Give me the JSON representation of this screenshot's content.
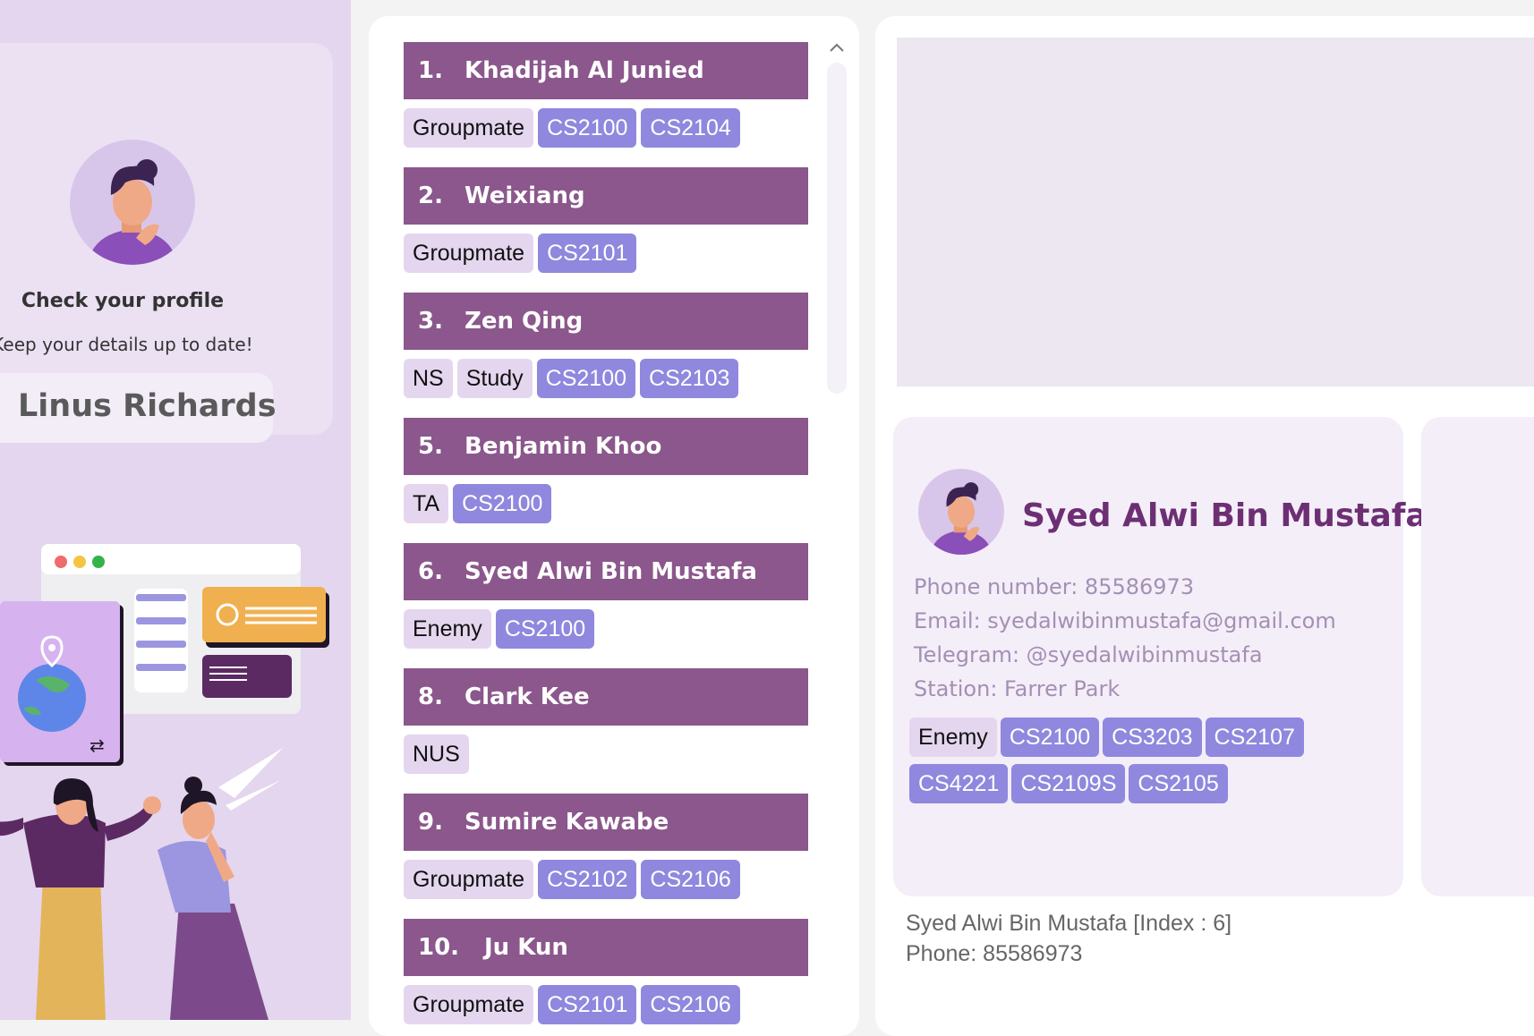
{
  "sidebar": {
    "profile_heading": "Check your profile",
    "profile_subtitle": "Keep your details up to date!",
    "user_name": "Linus Richards"
  },
  "contacts": [
    {
      "index": "1.",
      "name": "Khadijah Al Junied",
      "tags": [
        "Groupmate"
      ],
      "modules": [
        "CS2100",
        "CS2104"
      ]
    },
    {
      "index": "2.",
      "name": "Weixiang",
      "tags": [
        "Groupmate"
      ],
      "modules": [
        "CS2101"
      ]
    },
    {
      "index": "3.",
      "name": "Zen Qing",
      "tags": [
        "NS",
        "Study"
      ],
      "modules": [
        "CS2100",
        "CS2103"
      ]
    },
    {
      "index": "5.",
      "name": "Benjamin Khoo",
      "tags": [
        "TA"
      ],
      "modules": [
        "CS2100"
      ]
    },
    {
      "index": "6.",
      "name": "Syed Alwi Bin Mustafa",
      "tags": [
        "Enemy"
      ],
      "modules": [
        "CS2100"
      ]
    },
    {
      "index": "8.",
      "name": "Clark Kee",
      "tags": [
        "NUS"
      ],
      "modules": []
    },
    {
      "index": "9.",
      "name": "Sumire Kawabe",
      "tags": [
        "Groupmate"
      ],
      "modules": [
        "CS2102",
        "CS2106"
      ]
    },
    {
      "index": "10.",
      "name": "Ju Kun",
      "tags": [
        "Groupmate"
      ],
      "modules": [
        "CS2101",
        "CS2106"
      ]
    }
  ],
  "detail": {
    "name": "Syed Alwi Bin Mustafa",
    "phone": "Phone number: 85586973",
    "email": "Email: syedalwibinmustafa@gmail.com",
    "telegram": "Telegram: @syedalwibinmustafa",
    "station": "Station: Farrer Park",
    "tags": [
      "Enemy"
    ],
    "modules": [
      "CS2100",
      "CS3203",
      "CS2107",
      "CS4221",
      "CS2109S",
      "CS2105"
    ]
  },
  "status": {
    "line1": "Syed Alwi Bin Mustafa [Index : 6]",
    "line2": "Phone: 85586973"
  },
  "colors": {
    "header_purple": "#8b578c",
    "module_tag": "#8f88de",
    "plain_tag": "#e5d6ef",
    "detail_name": "#6d2f73"
  }
}
